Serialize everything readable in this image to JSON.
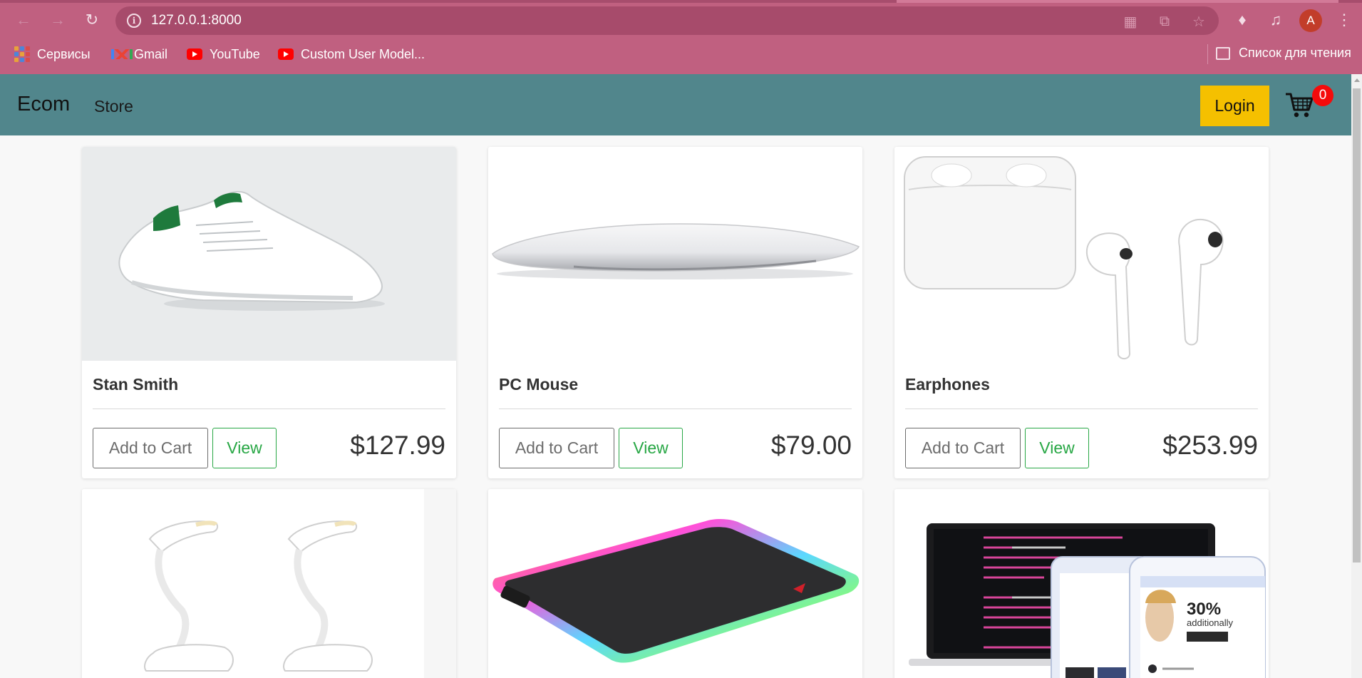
{
  "browser": {
    "url": "127.0.0.1:8000",
    "bookmarks": [
      {
        "label": "Сервисы",
        "icon": "apps-grid-icon"
      },
      {
        "label": "Gmail",
        "icon": "gmail-icon"
      },
      {
        "label": "YouTube",
        "icon": "youtube-icon"
      },
      {
        "label": "Custom User Model...",
        "icon": "youtube-icon"
      }
    ],
    "reading_list_label": "Список для чтения",
    "profile_initial": "A"
  },
  "navbar": {
    "brand": "Ecom",
    "store_link": "Store",
    "login_label": "Login",
    "cart_count": "0"
  },
  "products": [
    {
      "name": "Stan Smith",
      "price": "$127.99",
      "add_label": "Add to Cart",
      "view_label": "View"
    },
    {
      "name": "PC Mouse",
      "price": "$79.00",
      "add_label": "Add to Cart",
      "view_label": "View"
    },
    {
      "name": "Earphones",
      "price": "$253.99",
      "add_label": "Add to Cart",
      "view_label": "View"
    },
    {
      "name": "",
      "price": "",
      "add_label": "",
      "view_label": ""
    },
    {
      "name": "",
      "price": "",
      "add_label": "",
      "view_label": ""
    },
    {
      "name": "",
      "price": "",
      "add_label": "",
      "view_label": ""
    }
  ],
  "colors": {
    "chrome": "#c06080",
    "navbar": "#51868c",
    "login": "#f5c000",
    "badge": "#f50b0b",
    "view_button": "#28a745"
  }
}
